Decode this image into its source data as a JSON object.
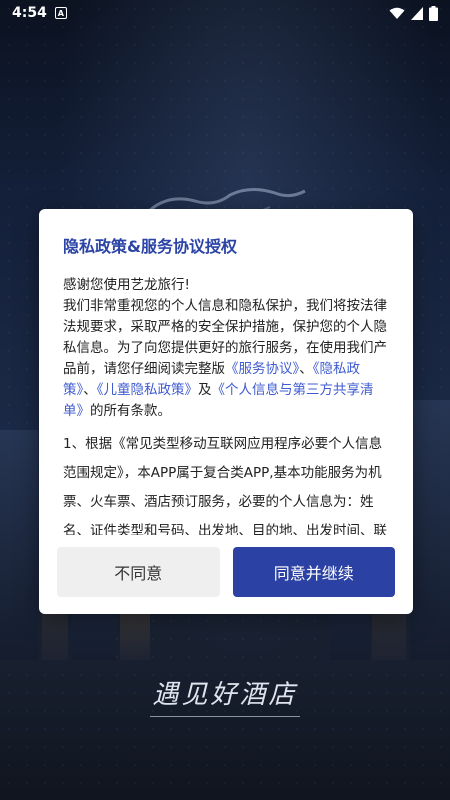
{
  "status_bar": {
    "time": "4:54",
    "notification_icon": "a-box-icon",
    "icons": [
      "wifi-icon",
      "signal-icon",
      "battery-icon"
    ]
  },
  "background": {
    "slogan": "遇见好酒店"
  },
  "dialog": {
    "title": "隐私政策&服务协议授权",
    "greeting": "感谢您使用艺龙旅行!",
    "para1_text": "我们非常重视您的个人信息和隐私保护，我们将按法律法规要求，采取严格的安全保护措施，保护您的个人隐私信息。为了向您提供更好的旅行服务，在使用我们产品前，请您仔细阅读完整版",
    "link_service": "《服务协议》",
    "sep1": "、",
    "link_privacy": "《隐私政策》",
    "sep2": "、",
    "link_child": "《儿童隐私政策》",
    "sep3": "及",
    "link_share": "《个人信息与第三方共享清单》",
    "para1_end": "的所有条款。",
    "para2": "1、根据《常见类型移动互联网应用程序必要个人信息范围规定》，本APP属于复合类APP,基本功能服务为机票、火车票、酒店预订服务，必要的个人信息为：姓名、证件类型和号码、出发地、目的地、出发时间、联系电话",
    "disagree_label": "不同意",
    "agree_label": "同意并继续"
  }
}
